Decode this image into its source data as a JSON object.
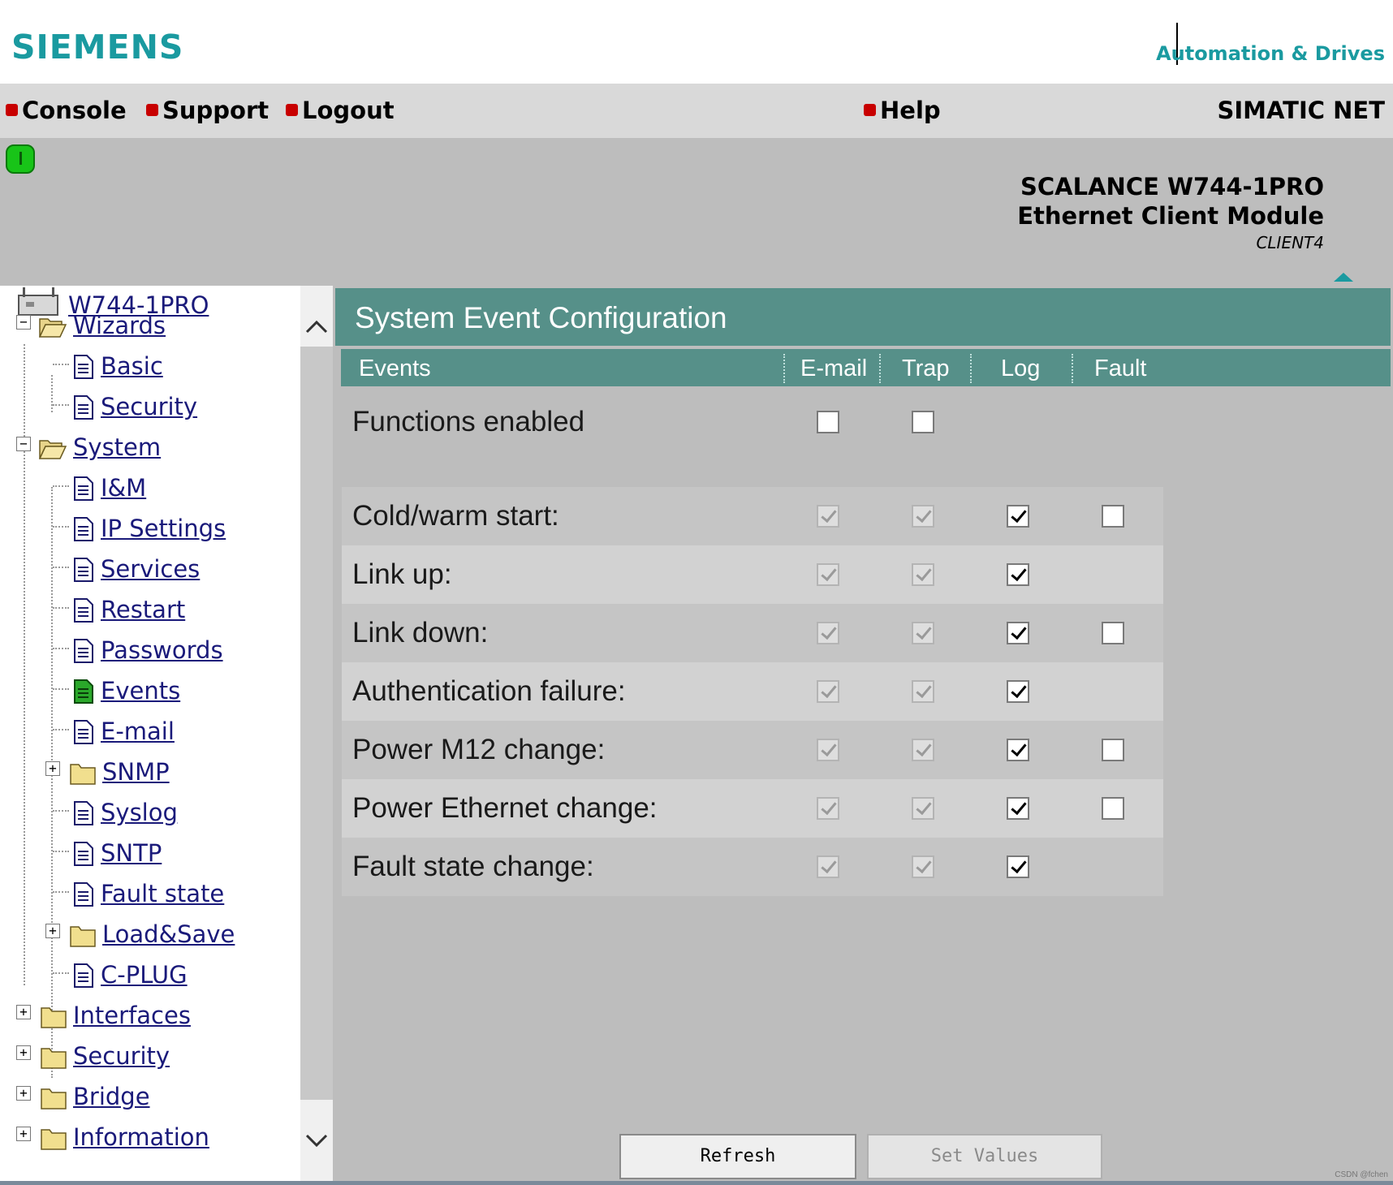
{
  "header": {
    "logo": "SIEMENS",
    "brand_right": "Automation & Drives"
  },
  "menu": {
    "items": [
      {
        "label": "Console"
      },
      {
        "label": "Support"
      },
      {
        "label": "Logout"
      },
      {
        "label": "Help"
      }
    ],
    "product": "SIMATIC NET"
  },
  "device": {
    "name": "SCALANCE W744-1PRO",
    "module": "Ethernet Client Module",
    "id": "CLIENT4"
  },
  "nav": {
    "root": "W744-1PRO",
    "items": [
      {
        "label": "Wizards",
        "type": "folder-open"
      },
      {
        "label": "Basic",
        "type": "page"
      },
      {
        "label": "Security",
        "type": "page"
      },
      {
        "label": "System",
        "type": "folder-open"
      },
      {
        "label": "I&M",
        "type": "page"
      },
      {
        "label": "IP Settings",
        "type": "page"
      },
      {
        "label": "Services",
        "type": "page"
      },
      {
        "label": "Restart",
        "type": "page"
      },
      {
        "label": "Passwords",
        "type": "page"
      },
      {
        "label": "Events",
        "type": "page-active"
      },
      {
        "label": "E-mail",
        "type": "page"
      },
      {
        "label": "SNMP",
        "type": "folder"
      },
      {
        "label": "Syslog",
        "type": "page"
      },
      {
        "label": "SNTP",
        "type": "page"
      },
      {
        "label": "Fault state",
        "type": "page"
      },
      {
        "label": "Load&Save",
        "type": "folder"
      },
      {
        "label": "C-PLUG",
        "type": "page"
      },
      {
        "label": "Interfaces",
        "type": "folder"
      },
      {
        "label": "Security",
        "type": "folder"
      },
      {
        "label": "Bridge",
        "type": "folder"
      },
      {
        "label": "Information",
        "type": "folder"
      }
    ]
  },
  "content": {
    "title": "System Event Configuration",
    "columns": {
      "events": "Events",
      "email": "E-mail",
      "trap": "Trap",
      "log": "Log",
      "fault": "Fault"
    },
    "functions_enabled": {
      "label": "Functions enabled",
      "email": false,
      "trap": false
    },
    "events": [
      {
        "label": "Cold/warm start:",
        "email": true,
        "trap": true,
        "log": true,
        "fault": false,
        "has_fault": true
      },
      {
        "label": "Link up:",
        "email": true,
        "trap": true,
        "log": true,
        "has_fault": false
      },
      {
        "label": "Link down:",
        "email": true,
        "trap": true,
        "log": true,
        "fault": false,
        "has_fault": true
      },
      {
        "label": "Authentication failure:",
        "email": true,
        "trap": true,
        "log": true,
        "has_fault": false
      },
      {
        "label": "Power M12 change:",
        "email": true,
        "trap": true,
        "log": true,
        "fault": false,
        "has_fault": true
      },
      {
        "label": "Power Ethernet change:",
        "email": true,
        "trap": true,
        "log": true,
        "fault": false,
        "has_fault": true
      },
      {
        "label": "Fault state change:",
        "email": true,
        "trap": true,
        "log": true,
        "has_fault": false
      }
    ],
    "buttons": {
      "refresh": "Refresh",
      "set_values": "Set Values"
    }
  },
  "colors": {
    "brand_teal": "#1a9aa0",
    "title_bar": "#569089",
    "menu_bullet": "#c80000",
    "status_led": "#18c418"
  },
  "footer": {
    "watermark": "CSDN @fchen"
  }
}
